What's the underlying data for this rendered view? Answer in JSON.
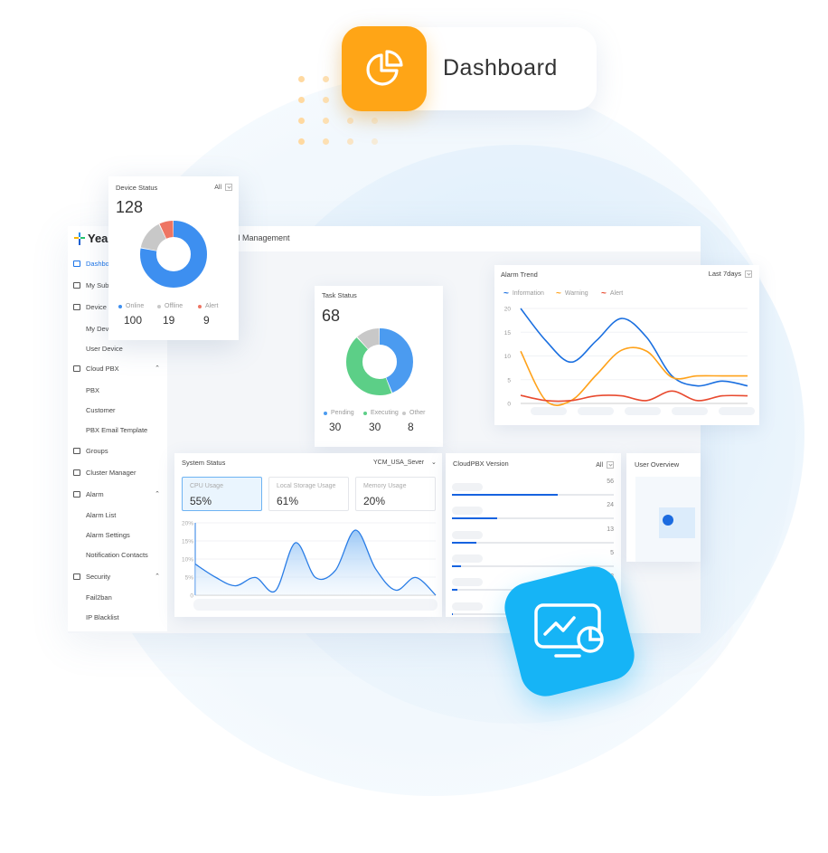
{
  "hero": {
    "title": "Dashboard",
    "icon": "pie-chart-icon",
    "accent": "#ffa516",
    "tile_icon": "monitor-chart-icon",
    "tile_color": "#16b4f6"
  },
  "app": {
    "logo_text": "Yeas",
    "header_title": "tral Management"
  },
  "sidebar": {
    "items": [
      {
        "label": "Dashbo",
        "icon": true,
        "active": true
      },
      {
        "label": "My Sub",
        "icon": true
      },
      {
        "label": "Device",
        "icon": true
      },
      {
        "label": "My Dev",
        "sub": true
      },
      {
        "label": "User Device",
        "sub": true
      },
      {
        "label": "Cloud PBX",
        "icon": true,
        "chev": true
      },
      {
        "label": "PBX",
        "sub": true
      },
      {
        "label": "Customer",
        "sub": true
      },
      {
        "label": "PBX Email Template",
        "sub": true
      },
      {
        "label": "Groups",
        "icon": true
      },
      {
        "label": "Cluster Manager",
        "icon": true
      },
      {
        "label": "Alarm",
        "icon": true,
        "chev": true
      },
      {
        "label": "Alarm List",
        "sub": true
      },
      {
        "label": "Alarm Settings",
        "sub": true
      },
      {
        "label": "Notification Contacts",
        "sub": true
      },
      {
        "label": "Security",
        "icon": true,
        "chev": true
      },
      {
        "label": "Fail2ban",
        "sub": true
      },
      {
        "label": "IP Blacklist",
        "sub": true
      }
    ]
  },
  "device_status": {
    "title": "Device Status",
    "filter": "All",
    "total": "128",
    "segments": [
      {
        "label": "Online",
        "value": 100,
        "color": "#3d8ff0"
      },
      {
        "label": "Offline",
        "value": 19,
        "color": "#c8c8c8"
      },
      {
        "label": "Alert",
        "value": 9,
        "color": "#ee7563"
      }
    ]
  },
  "task_status": {
    "title": "Task Status",
    "total": "68",
    "segments": [
      {
        "label": "Pending",
        "value": 30,
        "color": "#4b9bf0"
      },
      {
        "label": "Executing",
        "value": 30,
        "color": "#5ccf87"
      },
      {
        "label": "Other",
        "value": 8,
        "color": "#c8c8c8"
      }
    ]
  },
  "chart_data": [
    {
      "type": "line",
      "title": "Alarm Trend",
      "filter": "Last 7days",
      "ylim": [
        0,
        20
      ],
      "yticks": [
        "0",
        "5",
        "10",
        "15",
        "20"
      ],
      "grid": true,
      "legend": "top-left",
      "series": [
        {
          "name": "Information",
          "color": "#1a6fe0",
          "values": [
            20,
            13.2,
            8.7,
            13.2,
            17.9,
            13.9,
            5.8,
            3.7,
            4.7,
            3.7
          ]
        },
        {
          "name": "Warning",
          "color": "#ffa21a",
          "values": [
            11,
            0.6,
            0.6,
            6,
            11.2,
            11,
            5.5,
            5.8,
            5.8,
            5.8
          ]
        },
        {
          "name": "Alert",
          "color": "#e84a2f",
          "values": [
            1.7,
            0.6,
            0.6,
            1.6,
            1.6,
            0.6,
            2.6,
            0.6,
            1.6,
            1.6
          ]
        }
      ]
    },
    {
      "type": "area",
      "title": "System Status",
      "ylim": [
        0,
        20
      ],
      "yticks": [
        "0",
        "5%",
        "10%",
        "15%",
        "20%"
      ],
      "grid": true,
      "series": [
        {
          "name": "CPU Usage",
          "color": "#2a7de6",
          "values": [
            8.6,
            5,
            2.6,
            4.9,
            1.2,
            14.5,
            4.9,
            6.9,
            18,
            7.3,
            1.4,
            4.9,
            0
          ]
        }
      ]
    },
    {
      "type": "bar",
      "title": "CloudPBX Version",
      "filter": "All",
      "values": [
        56,
        24,
        13,
        5,
        3,
        0.5
      ],
      "labels": [
        "56",
        "24",
        "13",
        "5",
        "3",
        ""
      ]
    }
  ],
  "system_status": {
    "server": "YCM_USA_Sever",
    "metrics": [
      {
        "label": "CPU Usage",
        "value": "55%",
        "selected": true
      },
      {
        "label": "Local Storage Usage",
        "value": "61%"
      },
      {
        "label": "Memory Usage",
        "value": "20%"
      }
    ]
  },
  "user_overview": {
    "title": "User Overview"
  }
}
